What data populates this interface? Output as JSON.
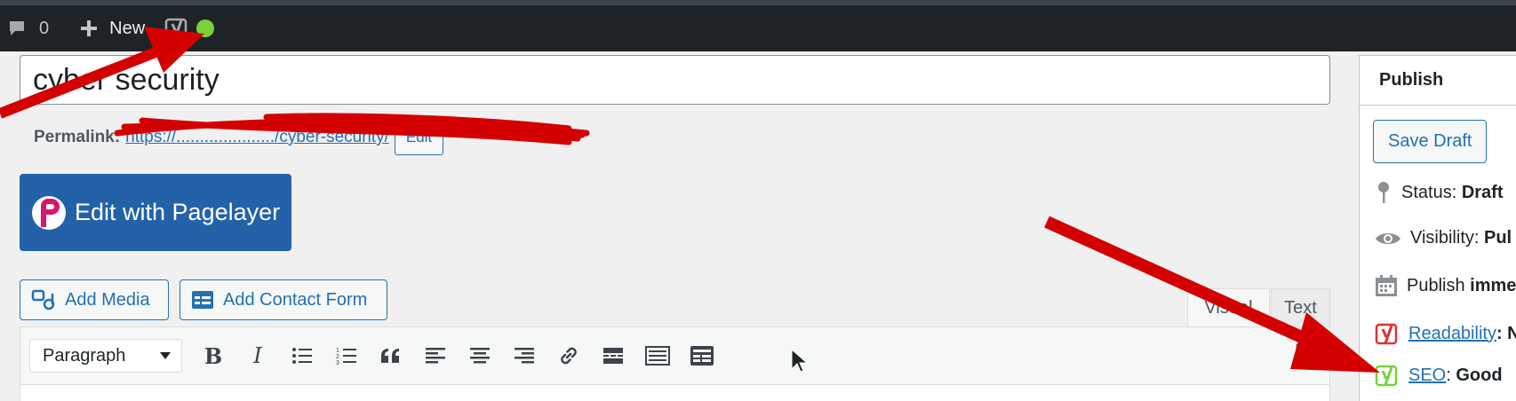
{
  "adminbar": {
    "comment_count": "0",
    "new_label": "New"
  },
  "title": {
    "value": "cyber security"
  },
  "permalink": {
    "label": "Permalink:",
    "url_visible": "https://...................../cyber-security/",
    "edit_label": "Edit"
  },
  "pagelayer": {
    "label": "Edit with Pagelayer"
  },
  "media_buttons": {
    "add_media": "Add Media",
    "add_contact_form": "Add Contact Form"
  },
  "editor_tabs": {
    "visual": "Visual",
    "text": "Text"
  },
  "toolbar": {
    "format_selected": "Paragraph",
    "bold": "B",
    "italic": "I"
  },
  "publish": {
    "heading": "Publish",
    "save_draft": "Save Draft",
    "status_label": "Status:",
    "status_value": "Draft",
    "visibility_label": "Visibility:",
    "visibility_value": "Pul",
    "publish_label": "Publish",
    "publish_value": "imme",
    "readability_link": "Readability",
    "readability_value": ": N",
    "seo_link": "SEO",
    "seo_value": "Good"
  },
  "colors": {
    "adminbar_bg": "#1d2327",
    "primary": "#2271b1",
    "pagelayer_bg": "#2362a8",
    "status_dot": "#7ad03a",
    "annotation_red": "#d40000",
    "yoast_good": "#7ad03a",
    "yoast_bad": "#dc3232"
  }
}
